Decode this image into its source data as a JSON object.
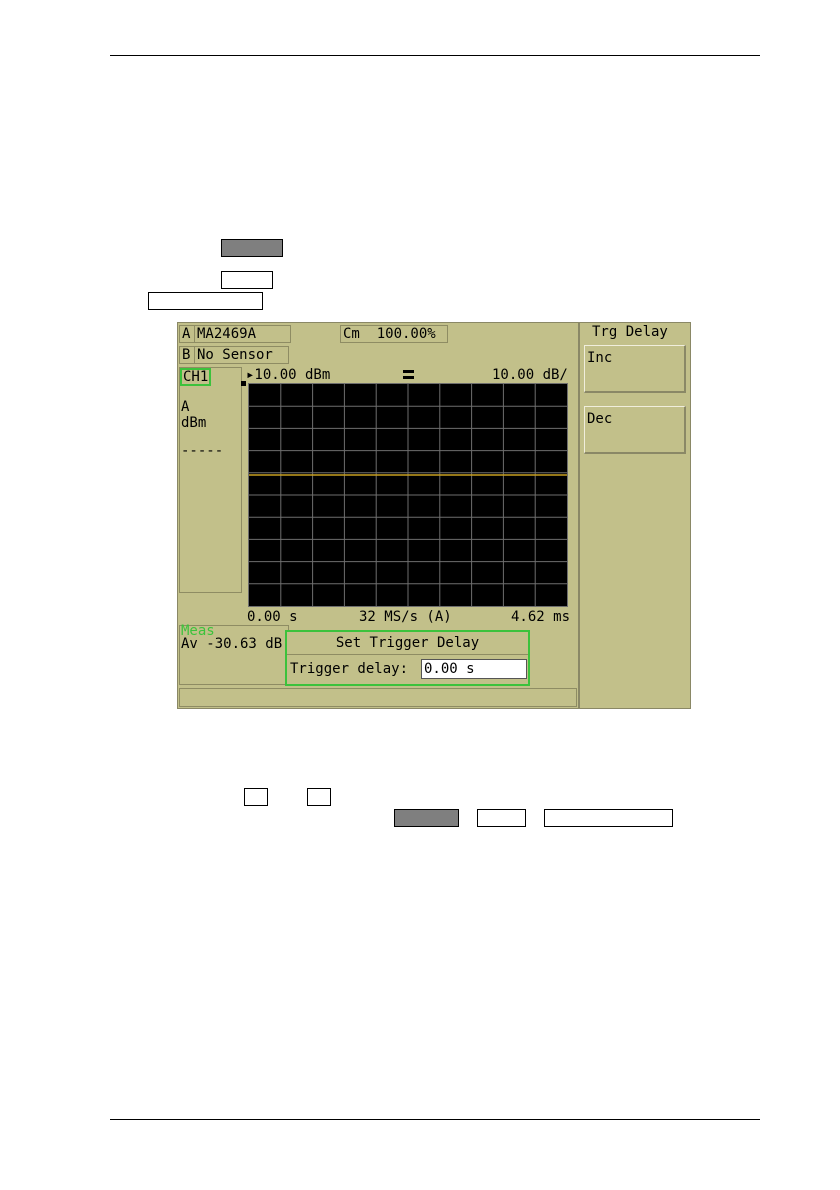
{
  "screen": {
    "sensor_a": {
      "letter": "A",
      "name": "MA2469A"
    },
    "cm": {
      "label": "Cm",
      "value": "100.00%"
    },
    "sensor_b": {
      "letter": "B",
      "name": "No Sensor"
    },
    "channel": "CH1",
    "ref_level": "▸10.00 dBm",
    "scale": "10.00 dB/",
    "side": {
      "sensor": "A",
      "unit": "dBm",
      "line": "-----"
    },
    "x_start": "0.00 s",
    "sample_rate": "32 MS/s (A)",
    "x_end": "4.62 ms",
    "meas_label": "Meas",
    "meas_value": "Av  -30.63 dB",
    "menu": {
      "title": "Trg Delay",
      "inc": "Inc",
      "dec": "Dec"
    },
    "dialog": {
      "title": "Set Trigger Delay",
      "label": "Trigger delay:",
      "value": "0.00 s"
    }
  },
  "colors": {
    "screen_bg": "#c2c08a",
    "trace": "#c8a020",
    "highlight": "#3cc23c",
    "grid": "#6e6e6e"
  },
  "trace": {
    "level_fraction_from_top": 0.41
  }
}
